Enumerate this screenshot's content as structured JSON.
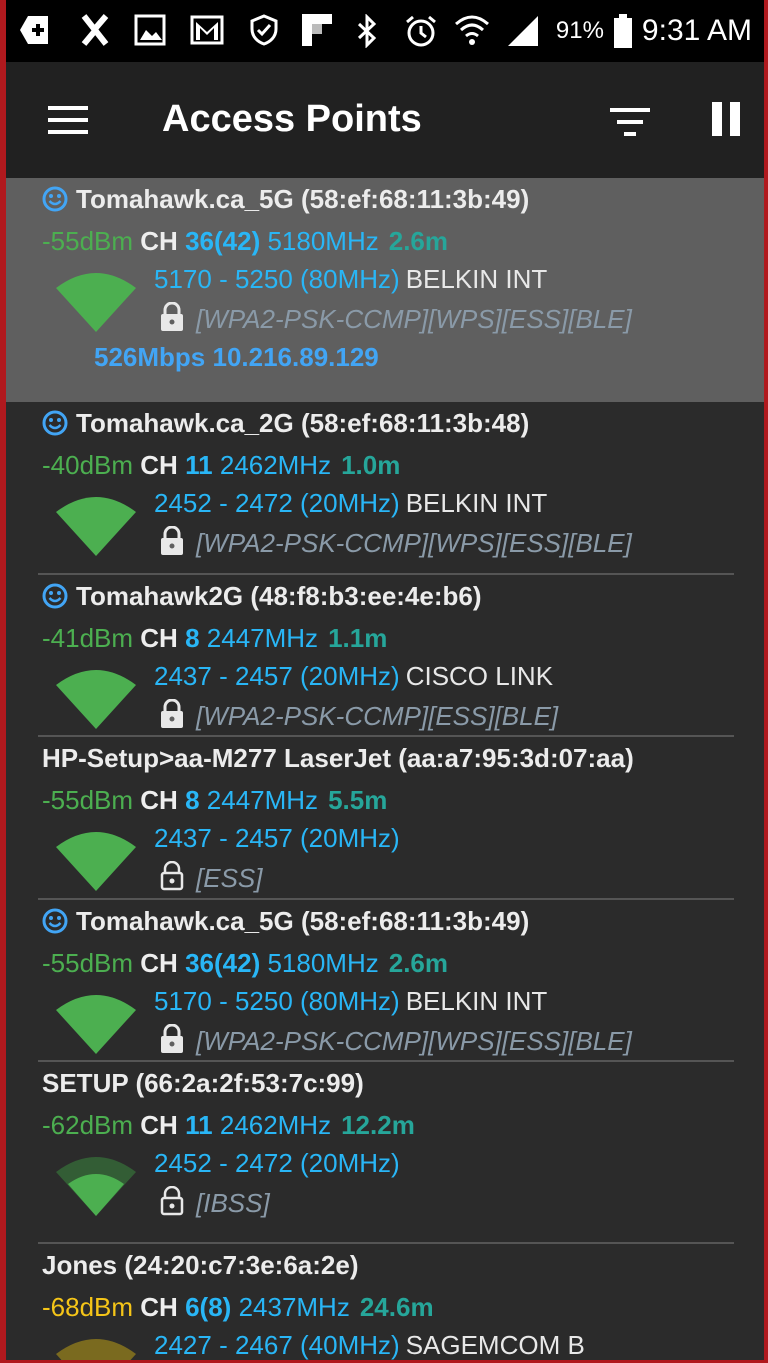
{
  "status_bar": {
    "battery_pct": "91%",
    "time": "9:31 AM",
    "icons": [
      "add-icon",
      "k-app-icon",
      "image-icon",
      "gmail-icon",
      "shield-check-icon",
      "flipboard-icon",
      "bluetooth-icon",
      "alarm-icon",
      "wifi-status-icon",
      "cell-signal-icon",
      "battery-icon"
    ]
  },
  "app_bar": {
    "title": "Access Points",
    "icons": [
      "menu-icon",
      "filter-icon",
      "pause-icon"
    ]
  },
  "colors": {
    "signal_good": "#4caf50",
    "signal_weak": "#f5c518",
    "channel": "#29b6f6",
    "distance": "#26a69a",
    "selected_row": "#5f5f5f",
    "background": "#2b2b2b",
    "app_bar": "#212121"
  },
  "access_points": [
    {
      "ssid": "Tomahawk.ca_5G (58:ef:68:11:3b:49)",
      "has_smile": true,
      "dbm": "-55dBm",
      "ch_label": "CH",
      "channel": "36(42)",
      "freq": "5180MHz",
      "distance": "2.6m",
      "range": "5170 - 5250 (80MHz)",
      "vendor": "BELKIN INT",
      "security": "[WPA2-PSK-CCMP][WPS][ESS][BLE]",
      "locked": true,
      "extra": "526Mbps 10.216.89.129",
      "selected": true
    },
    {
      "ssid": "Tomahawk.ca_2G (58:ef:68:11:3b:48)",
      "has_smile": true,
      "dbm": "-40dBm",
      "ch_label": "CH",
      "channel": "11",
      "freq": "2462MHz",
      "distance": "1.0m",
      "range": "2452 - 2472 (20MHz)",
      "vendor": "BELKIN INT",
      "security": "[WPA2-PSK-CCMP][WPS][ESS][BLE]",
      "locked": true
    },
    {
      "ssid": "Tomahawk2G (48:f8:b3:ee:4e:b6)",
      "has_smile": true,
      "dbm": "-41dBm",
      "ch_label": "CH",
      "channel": "8",
      "freq": "2447MHz",
      "distance": "1.1m",
      "range": "2437 - 2457 (20MHz)",
      "vendor": "CISCO LINK",
      "security": "[WPA2-PSK-CCMP][ESS][BLE]",
      "locked": true
    },
    {
      "ssid": "HP-Setup>aa-M277 LaserJet (aa:a7:95:3d:07:aa)",
      "has_smile": false,
      "dbm": "-55dBm",
      "ch_label": "CH",
      "channel": "8",
      "freq": "2447MHz",
      "distance": "5.5m",
      "range": "2437 - 2457 (20MHz)",
      "vendor": "",
      "security": "[ESS]",
      "locked": false
    },
    {
      "ssid": "Tomahawk.ca_5G (58:ef:68:11:3b:49)",
      "has_smile": true,
      "dbm": "-55dBm",
      "ch_label": "CH",
      "channel": "36(42)",
      "freq": "5180MHz",
      "distance": "2.6m",
      "range": "5170 - 5250 (80MHz)",
      "vendor": "BELKIN INT",
      "security": "[WPA2-PSK-CCMP][WPS][ESS][BLE]",
      "locked": true
    },
    {
      "ssid": "SETUP (66:2a:2f:53:7c:99)",
      "has_smile": false,
      "dbm": "-62dBm",
      "ch_label": "CH",
      "channel": "11",
      "freq": "2462MHz",
      "distance": "12.2m",
      "range": "2452 - 2472 (20MHz)",
      "vendor": "",
      "security": "[IBSS]",
      "locked": false,
      "signal_level": 0.75
    },
    {
      "ssid": "Jones (24:20:c7:3e:6a:2e)",
      "has_smile": false,
      "dbm": "-68dBm",
      "ch_label": "CH",
      "channel": "6(8)",
      "freq": "2437MHz",
      "distance": "24.6m",
      "range": "2427 - 2467 (40MHz)",
      "vendor": "SAGEMCOM B",
      "security": "",
      "locked": true,
      "weak": true
    }
  ]
}
